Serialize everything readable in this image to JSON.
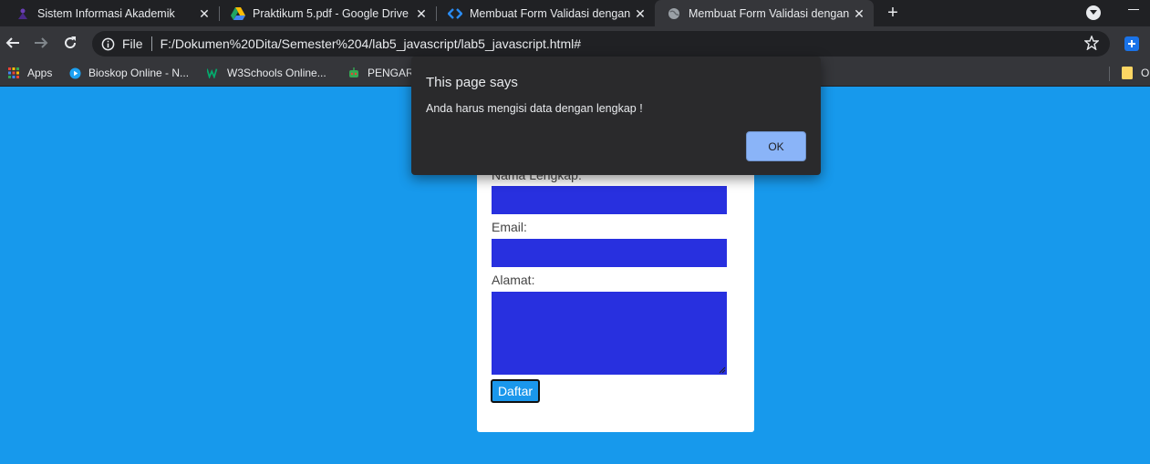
{
  "browser": {
    "tabs": [
      {
        "title": "Sistem Informasi Akademik",
        "icon": "university-icon",
        "active": false
      },
      {
        "title": "Praktikum 5.pdf - Google Drive",
        "icon": "google-drive-icon",
        "active": false
      },
      {
        "title": "Membuat Form Validasi dengan Ja",
        "icon": "code-icon",
        "active": false
      },
      {
        "title": "Membuat Form Validasi dengan Ja",
        "icon": "globe-icon",
        "active": true
      }
    ],
    "address": {
      "scheme_label": "File",
      "url": "F:/Dokumen%20Dita/Semester%204/lab5_javascript/lab5_javascript.html#"
    },
    "bookmarks": [
      {
        "label": "Apps",
        "icon": "apps-grid-icon"
      },
      {
        "label": "Bioskop Online - N...",
        "icon": "play-circle-icon"
      },
      {
        "label": "W3Schools Online...",
        "icon": "w3schools-icon"
      },
      {
        "label": "PENGAR",
        "icon": "robot-icon"
      },
      {
        "label": "O",
        "icon": "folder-icon"
      }
    ]
  },
  "form": {
    "name_label": "Nama Lengkap:",
    "email_label": "Email:",
    "address_label": "Alamat:",
    "submit_label": "Daftar",
    "input_color": "#2830df",
    "page_bg": "#1799ec"
  },
  "dialog": {
    "title": "This page says",
    "message": "Anda harus mengisi data dengan lengkap !",
    "ok_label": "OK"
  }
}
